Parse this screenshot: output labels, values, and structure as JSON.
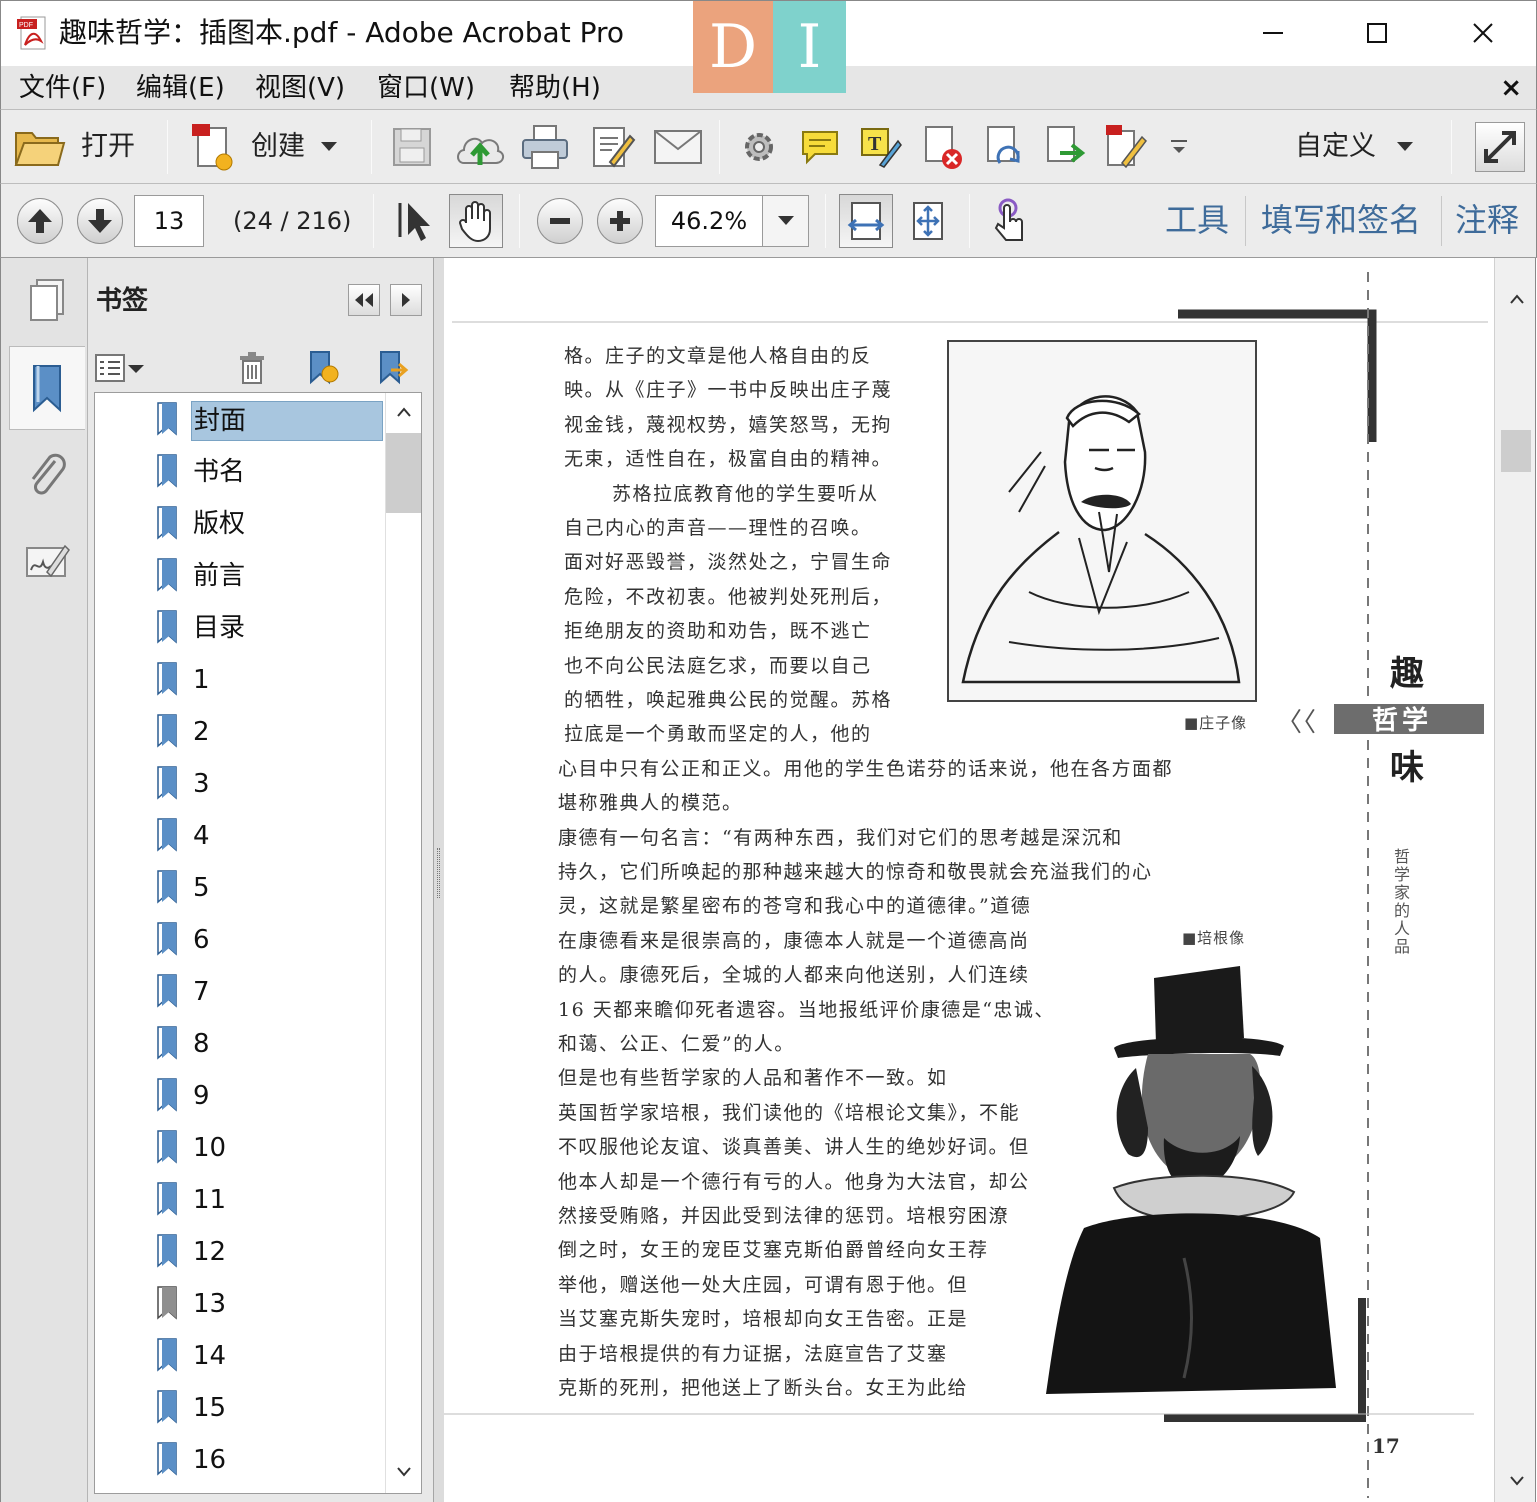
{
  "window": {
    "title": "趣味哲学：插图本.pdf - Adobe Acrobat Pro",
    "badge_left": "D",
    "badge_right": "I"
  },
  "menu": {
    "items": [
      "文件(F)",
      "编辑(E)",
      "视图(V)",
      "窗口(W)",
      "帮助(H)"
    ],
    "close_glyph": "×"
  },
  "toolbar": {
    "open_label": "打开",
    "create_label": "创建",
    "customize_label": "自定义"
  },
  "nav": {
    "current_page": "13",
    "page_count": "(24 / 216)",
    "zoom": "46.2%"
  },
  "panes": {
    "tools": "工具",
    "fill_sign": "填写和签名",
    "comment": "注释"
  },
  "bookmarks": {
    "title": "书签",
    "items": [
      "封面",
      "书名",
      "版权",
      "前言",
      "目录",
      "1",
      "2",
      "3",
      "4",
      "5",
      "6",
      "7",
      "8",
      "9",
      "10",
      "11",
      "12",
      "13",
      "14",
      "15",
      "16"
    ],
    "selected_index": 0,
    "current_index": 17
  },
  "page": {
    "lines": [
      "格。庄子的文章是他人格自由的反",
      "映。从《庄子》一书中反映出庄子蔑",
      "视金钱，蔑视权势，嬉笑怒骂，无拘",
      "无束，适性自在，极富自由的精神。",
      "苏格拉底教育他的学生要听从",
      "自己内心的声音——理性的召唤。",
      "面对好恶毁誉，淡然处之，宁冒生命",
      "危险，不改初衷。他被判处死刑后，",
      "拒绝朋友的资助和劝告，既不逃亡",
      "也不向公民法庭乞求，而要以自己",
      "的牺牲，唤起雅典公民的觉醒。苏格",
      "拉底是一个勇敢而坚定的人，他的",
      "心目中只有公正和正义。用他的学生色诺芬的话来说，他在各方面都",
      "堪称雅典人的模范。",
      "康德有一句名言：“有两种东西，我们对它们的思考越是深沉和",
      "持久，它们所唤起的那种越来越大的惊奇和敬畏就会充溢我们的心",
      "灵，这就是繁星密布的苍穹和我心中的道德律。”道德",
      "在康德看来是很崇高的，康德本人就是一个道德高尚",
      "的人。康德死后，全城的人都来向他送别，人们连续",
      "16 天都来瞻仰死者遗容。当地报纸评价康德是“忠诚、",
      "和蔼、公正、仁爱”的人。",
      "但是也有些哲学家的人品和著作不一致。如",
      "英国哲学家培根，我们读他的《培根论文集》，不能",
      "不叹服他论友谊、谈真善美、讲人生的绝妙好词。但",
      "他本人却是一个德行有亏的人。他身为大法官，却公",
      "然接受贿赂，并因此受到法律的惩罚。培根穷困潦",
      "倒之时，女王的宠臣艾塞克斯伯爵曾经向女王荐",
      "举他，赠送他一处大庄园，可谓有恩于他。但",
      "当艾塞克斯失宠时，培根却向女王告密。正是",
      "由于培根提供的有力证据，法庭宣告了艾塞",
      "克斯的死刑，把他送上了断头台。女王为此给"
    ],
    "caption_zhuangzi": "■庄子像",
    "caption_bacon": "■培根像",
    "side_char1": "趣",
    "side_band": "哲学",
    "side_char2": "味",
    "side_marks": "〈〈",
    "vertical_subtitle": "哲学家的人品",
    "page_number": "17"
  },
  "colors": {
    "pane_link": "#3e6b9a",
    "selection": "#a8c6df",
    "badge_d": "#eba37d",
    "badge_i": "#7fd2cc"
  }
}
